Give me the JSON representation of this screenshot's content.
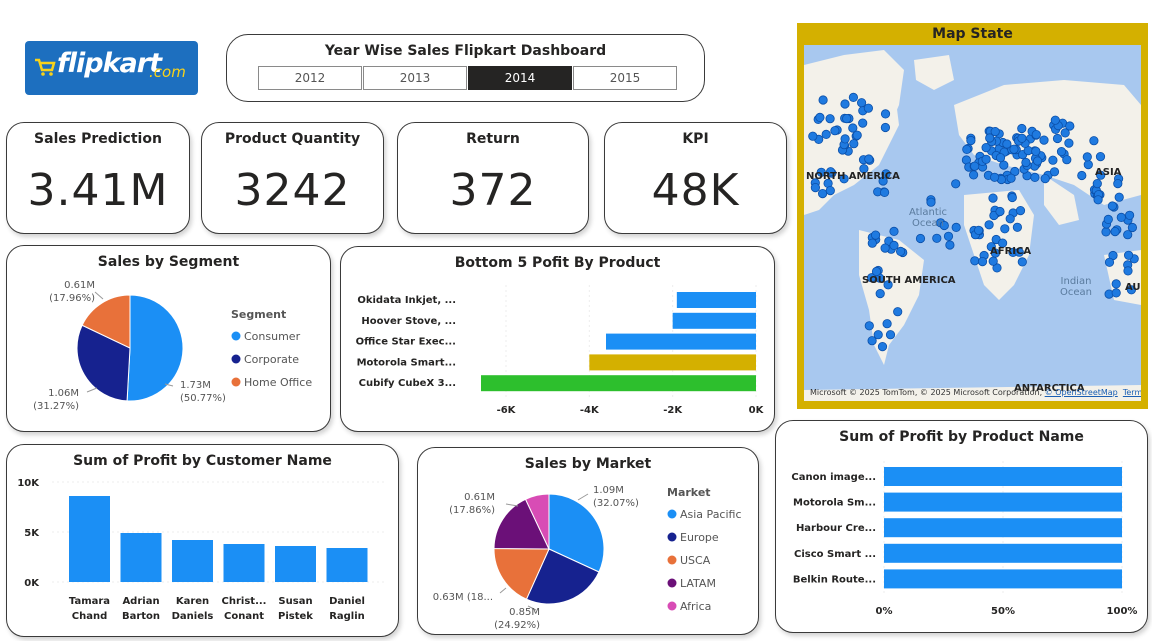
{
  "logo": {
    "word": "flipkart",
    "tld": ".com"
  },
  "header": {
    "title": "Year Wise Sales Flipkart Dashboard",
    "years": [
      "2012",
      "2013",
      "2014",
      "2015"
    ],
    "selected_year": "2014"
  },
  "kpis": [
    {
      "title": "Sales Prediction",
      "value": "3.41M"
    },
    {
      "title": "Product Quantity",
      "value": "3242"
    },
    {
      "title": "Return",
      "value": "372"
    },
    {
      "title": "KPI",
      "value": "48K"
    }
  ],
  "map": {
    "title": "Map State",
    "labels": [
      "NORTH AMERICA",
      "ASIA",
      "AFRICA",
      "SOUTH AMERICA",
      "ANTARCTICA",
      "AUS"
    ],
    "oceans": [
      "Atlantic Ocean",
      "Indian Ocean"
    ],
    "credit_brand": "Microsoft",
    "credit_text": "© 2025 TomTom, © 2025 Microsoft Corporation,",
    "credit_osm": "© OpenStreetMap",
    "credit_terms": "Terms",
    "marker_color": "#1f7ae0"
  },
  "chart_data": [
    {
      "type": "pie",
      "title": "Sales by Segment",
      "legend_title": "Segment",
      "slices": [
        {
          "name": "Consumer",
          "value": 1.73,
          "label": "1.73M",
          "pct": "(50.77%)",
          "color": "#1b8ff5"
        },
        {
          "name": "Corporate",
          "value": 1.06,
          "label": "1.06M",
          "pct": "(31.27%)",
          "color": "#16228f"
        },
        {
          "name": "Home Office",
          "value": 0.61,
          "label": "0.61M",
          "pct": "(17.96%)",
          "color": "#e8713a"
        }
      ]
    },
    {
      "type": "bar",
      "orientation": "horizontal",
      "title": "Bottom 5 Pofit By Product",
      "categories": [
        "Okidata Inkjet, ...",
        "Hoover Stove, ...",
        "Office Star Exec...",
        "Motorola Smart...",
        "Cubify CubeX 3..."
      ],
      "values": [
        -1900,
        -2000,
        -3600,
        -4000,
        -6600
      ],
      "colors": [
        "#1b8ff5",
        "#1b8ff5",
        "#1b8ff5",
        "#d4b000",
        "#2dbf2d"
      ],
      "xlim": [
        -6.6,
        0
      ],
      "ticks": [
        "-6K",
        "-4K",
        "-2K",
        "0K"
      ]
    },
    {
      "type": "bar",
      "title": "Sum of Profit by Customer Name",
      "categories": [
        "Tamara Chand",
        "Adrian Barton",
        "Karen Daniels",
        "Christ... Conant",
        "Susan Pistek",
        "Daniel Raglin"
      ],
      "values": [
        8600,
        4900,
        4200,
        3800,
        3600,
        3400
      ],
      "ylim": [
        0,
        10000
      ],
      "ticks": [
        "10K",
        "5K",
        "0K"
      ],
      "color": "#1b8ff5"
    },
    {
      "type": "pie",
      "title": "Sales by Market",
      "legend_title": "Market",
      "slices": [
        {
          "name": "Asia Pacific",
          "value": 1.09,
          "label": "1.09M",
          "pct": "(32.07%)",
          "color": "#1b8ff5"
        },
        {
          "name": "Europe",
          "value": 0.85,
          "label": "0.85M",
          "pct": "(24.92%)",
          "color": "#16228f"
        },
        {
          "name": "USCA",
          "value": 0.63,
          "label": "0.63M (18...",
          "pct": "",
          "color": "#e8713a"
        },
        {
          "name": "LATAM",
          "value": 0.61,
          "label": "0.61M",
          "pct": "(17.86%)",
          "color": "#6b1078"
        },
        {
          "name": "Africa",
          "value": 0.24,
          "label": "",
          "pct": "",
          "color": "#d84cb5"
        }
      ]
    },
    {
      "type": "bar",
      "orientation": "horizontal",
      "title": "Sum of Profit by Product Name",
      "categories": [
        "Canon image...",
        "Motorola Sm...",
        "Harbour Cre...",
        "Cisco Smart ...",
        "Belkin Route..."
      ],
      "values": [
        100,
        100,
        100,
        100,
        100
      ],
      "xlim": [
        0,
        100
      ],
      "ticks": [
        "0%",
        "50%",
        "100%"
      ],
      "color": "#1b8ff5"
    }
  ]
}
